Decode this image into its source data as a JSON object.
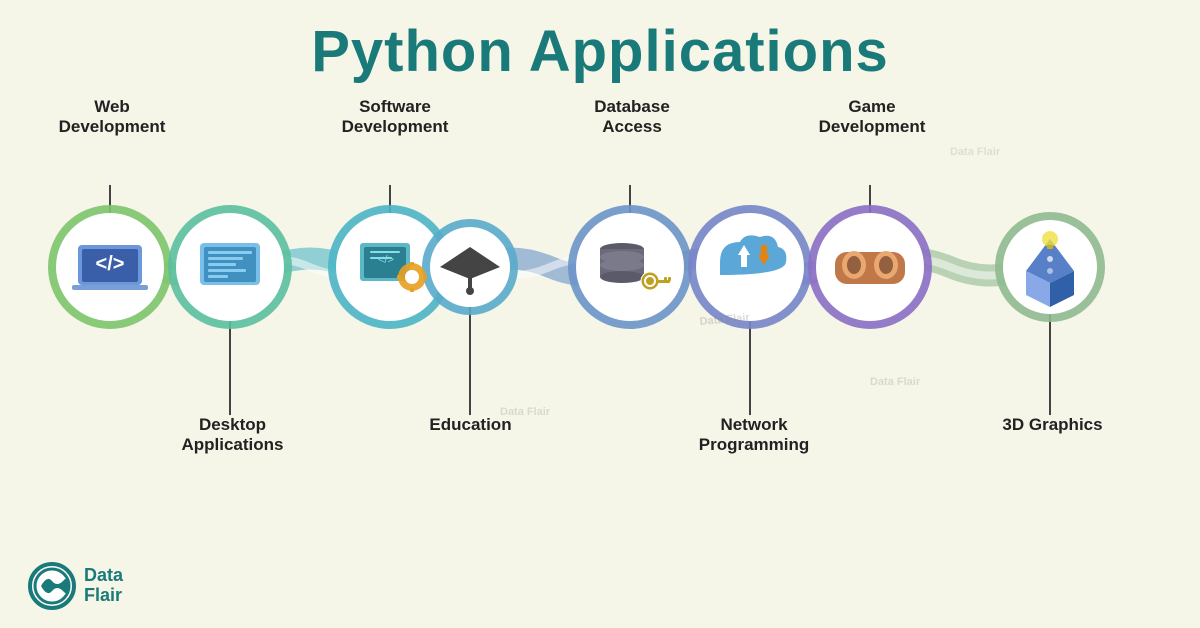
{
  "title": "Python Applications",
  "brand": {
    "name": "Data\nFlair",
    "tagline": "Data\nFlair"
  },
  "items": [
    {
      "id": "web-dev",
      "label": "Web\nDevelopment",
      "position": "above",
      "icon": "web",
      "color_outer": "#7dc56b",
      "color_inner": "#a8e08a"
    },
    {
      "id": "desktop-apps",
      "label": "Desktop\nApplications",
      "position": "below",
      "icon": "desktop",
      "color_outer": "#5bbf9f",
      "color_inner": "#85d4bb"
    },
    {
      "id": "software-dev",
      "label": "Software\nDevelopment",
      "position": "above",
      "icon": "software",
      "color_outer": "#4db5c5",
      "color_inner": "#7dcfd9"
    },
    {
      "id": "education",
      "label": "Education",
      "position": "below",
      "icon": "education",
      "color_outer": "#5aabcb",
      "color_inner": "#88c9e0"
    },
    {
      "id": "database",
      "label": "Database\nAccess",
      "position": "above",
      "icon": "database",
      "color_outer": "#6b95c8",
      "color_inner": "#90b5df"
    },
    {
      "id": "network",
      "label": "Network\nProgramming",
      "position": "below",
      "icon": "network",
      "color_outer": "#7585c8",
      "color_inner": "#9dacd8"
    },
    {
      "id": "game-dev",
      "label": "Game\nDevelopment",
      "position": "above",
      "icon": "game",
      "color_outer": "#8b6fc5",
      "color_inner": "#b09bd8"
    },
    {
      "id": "3d-graphics",
      "label": "3D Graphics",
      "position": "below",
      "icon": "3d",
      "color_outer": "#8fba8f",
      "color_inner": "#b5d4b5"
    }
  ]
}
